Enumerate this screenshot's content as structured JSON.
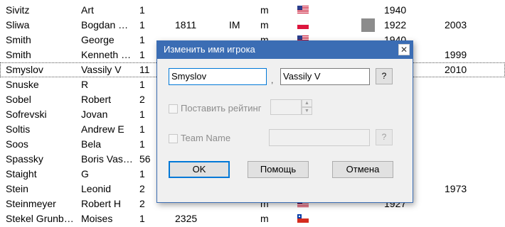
{
  "rows": [
    {
      "last": "Sivitz",
      "first": "Art",
      "games": "1",
      "rating": "",
      "title": "",
      "sex": "m",
      "flag": "us",
      "photo": false,
      "born": "1940",
      "died": ""
    },
    {
      "last": "Sliwa",
      "first": "Bogdan St...",
      "games": "1",
      "rating": "1811",
      "title": "IM",
      "sex": "m",
      "flag": "pl",
      "photo": true,
      "born": "1922",
      "died": "2003"
    },
    {
      "last": "Smith",
      "first": "George",
      "games": "1",
      "rating": "",
      "title": "",
      "sex": "m",
      "flag": "us",
      "photo": false,
      "born": "1940",
      "died": ""
    },
    {
      "last": "Smith",
      "first": "Kenneth R...",
      "games": "1",
      "rating": "",
      "title": "",
      "sex": "",
      "flag": "",
      "photo": false,
      "born": "",
      "died": "1999"
    },
    {
      "last": "Smyslov",
      "first": "Vassily V",
      "games": "11",
      "rating": "",
      "title": "",
      "sex": "",
      "flag": "",
      "photo": false,
      "born": "",
      "died": "2010",
      "selected": true
    },
    {
      "last": "Snuske",
      "first": "R",
      "games": "1",
      "rating": "",
      "title": "",
      "sex": "",
      "flag": "",
      "photo": false,
      "born": "",
      "died": ""
    },
    {
      "last": "Sobel",
      "first": "Robert",
      "games": "2",
      "rating": "",
      "title": "",
      "sex": "",
      "flag": "",
      "photo": false,
      "born": "",
      "died": ""
    },
    {
      "last": "Sofrevski",
      "first": "Jovan",
      "games": "1",
      "rating": "",
      "title": "",
      "sex": "",
      "flag": "",
      "photo": false,
      "born": "",
      "died": ""
    },
    {
      "last": "Soltis",
      "first": "Andrew E",
      "games": "1",
      "rating": "",
      "title": "",
      "sex": "",
      "flag": "",
      "photo": false,
      "born": "",
      "died": ""
    },
    {
      "last": "Soos",
      "first": "Bela",
      "games": "1",
      "rating": "",
      "title": "",
      "sex": "",
      "flag": "",
      "photo": false,
      "born": "",
      "died": ""
    },
    {
      "last": "Spassky",
      "first": "Boris Vasili...",
      "games": "56",
      "rating": "",
      "title": "",
      "sex": "",
      "flag": "",
      "photo": false,
      "born": "",
      "died": ""
    },
    {
      "last": "Staight",
      "first": "G",
      "games": "1",
      "rating": "",
      "title": "",
      "sex": "",
      "flag": "",
      "photo": false,
      "born": "",
      "died": ""
    },
    {
      "last": "Stein",
      "first": "Leonid",
      "games": "2",
      "rating": "",
      "title": "",
      "sex": "",
      "flag": "",
      "photo": false,
      "born": "",
      "died": "1973"
    },
    {
      "last": "Steinmeyer",
      "first": "Robert H",
      "games": "2",
      "rating": "",
      "title": "",
      "sex": "m",
      "flag": "us",
      "photo": false,
      "born": "1927",
      "died": ""
    },
    {
      "last": "Stekel Grunber...",
      "first": "Moises",
      "games": "1",
      "rating": "2325",
      "title": "",
      "sex": "m",
      "flag": "cl",
      "photo": false,
      "born": "",
      "died": ""
    }
  ],
  "dialog": {
    "title": "Изменить имя игрока",
    "close_glyph": "✕",
    "last_name_value": "Smyslov",
    "separator": ",",
    "first_name_value": "Vassily V",
    "help_glyph": "?",
    "set_rating_label": "Поставить рейтинг",
    "set_rating_value": "",
    "spin_up_glyph": "▲",
    "spin_down_glyph": "▼",
    "team_name_label": "Team Name",
    "team_name_value": "",
    "ok_label": "OK",
    "help_label": "Помощь",
    "cancel_label": "Отмена"
  }
}
